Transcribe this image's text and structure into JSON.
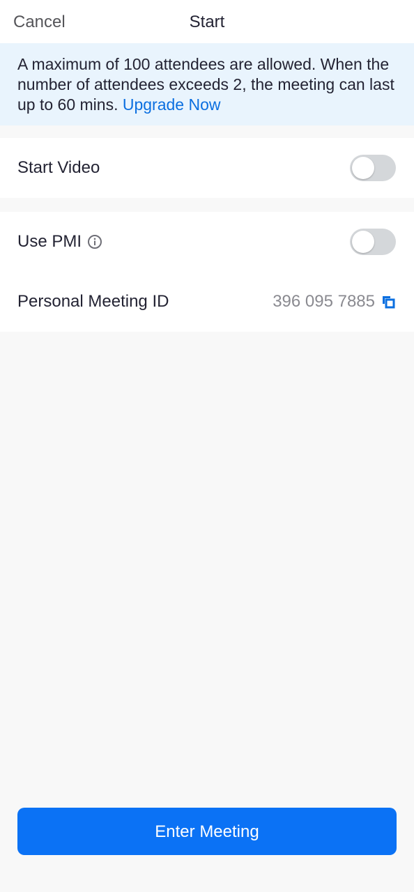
{
  "header": {
    "cancel_label": "Cancel",
    "title": "Start"
  },
  "notice": {
    "text": "A maximum of 100 attendees are allowed. When the number of attendees exceeds 2, the meeting can last up to 60 mins. ",
    "link_label": "Upgrade Now"
  },
  "settings": {
    "start_video": {
      "label": "Start Video",
      "enabled": false
    },
    "use_pmi": {
      "label": "Use PMI",
      "enabled": false,
      "icon": "info-icon"
    },
    "personal_meeting_id": {
      "label": "Personal Meeting ID",
      "value": "396 095 7885",
      "icon": "copy-icon"
    }
  },
  "footer": {
    "enter_label": "Enter Meeting"
  },
  "colors": {
    "accent": "#0b72f5",
    "link": "#0b6fe0",
    "notice_bg": "#e9f4fd",
    "toggle_off": "#d4d7da"
  }
}
